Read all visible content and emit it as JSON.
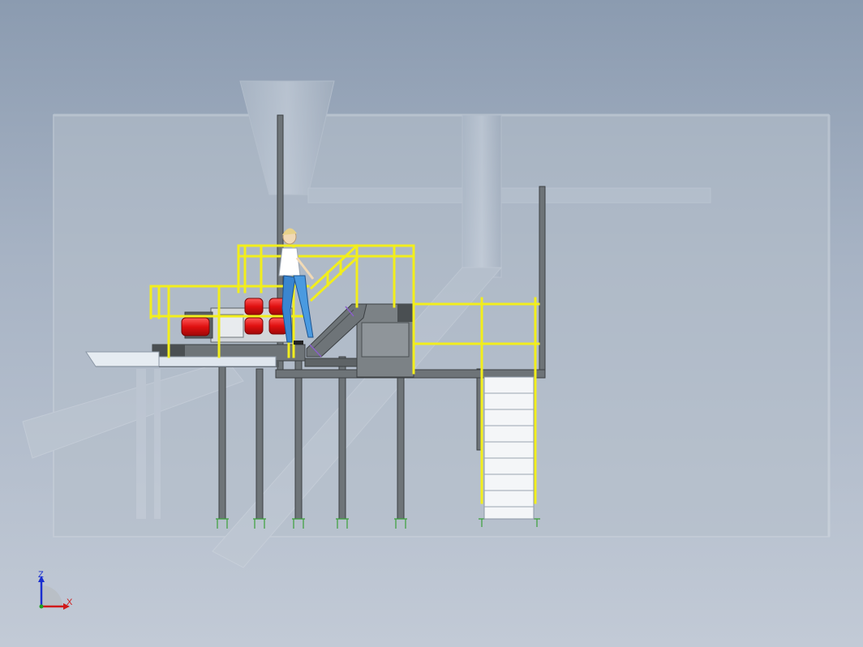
{
  "viewport": {
    "background_top": "#8b9bb0",
    "background_bottom": "#c2cad6"
  },
  "colors": {
    "handrail": "#f2ee1c",
    "steel": "#6e7478",
    "steel_dark": "#4a4f52",
    "motor": "#e01010",
    "ghost": "#c3ccd6",
    "stair_tread": "#f4f6f8"
  },
  "triad": {
    "z_label": "Z",
    "x_label": "X",
    "z_color": "#1a2fd0",
    "x_color": "#d01a1a",
    "origin_color": "#20a020"
  }
}
